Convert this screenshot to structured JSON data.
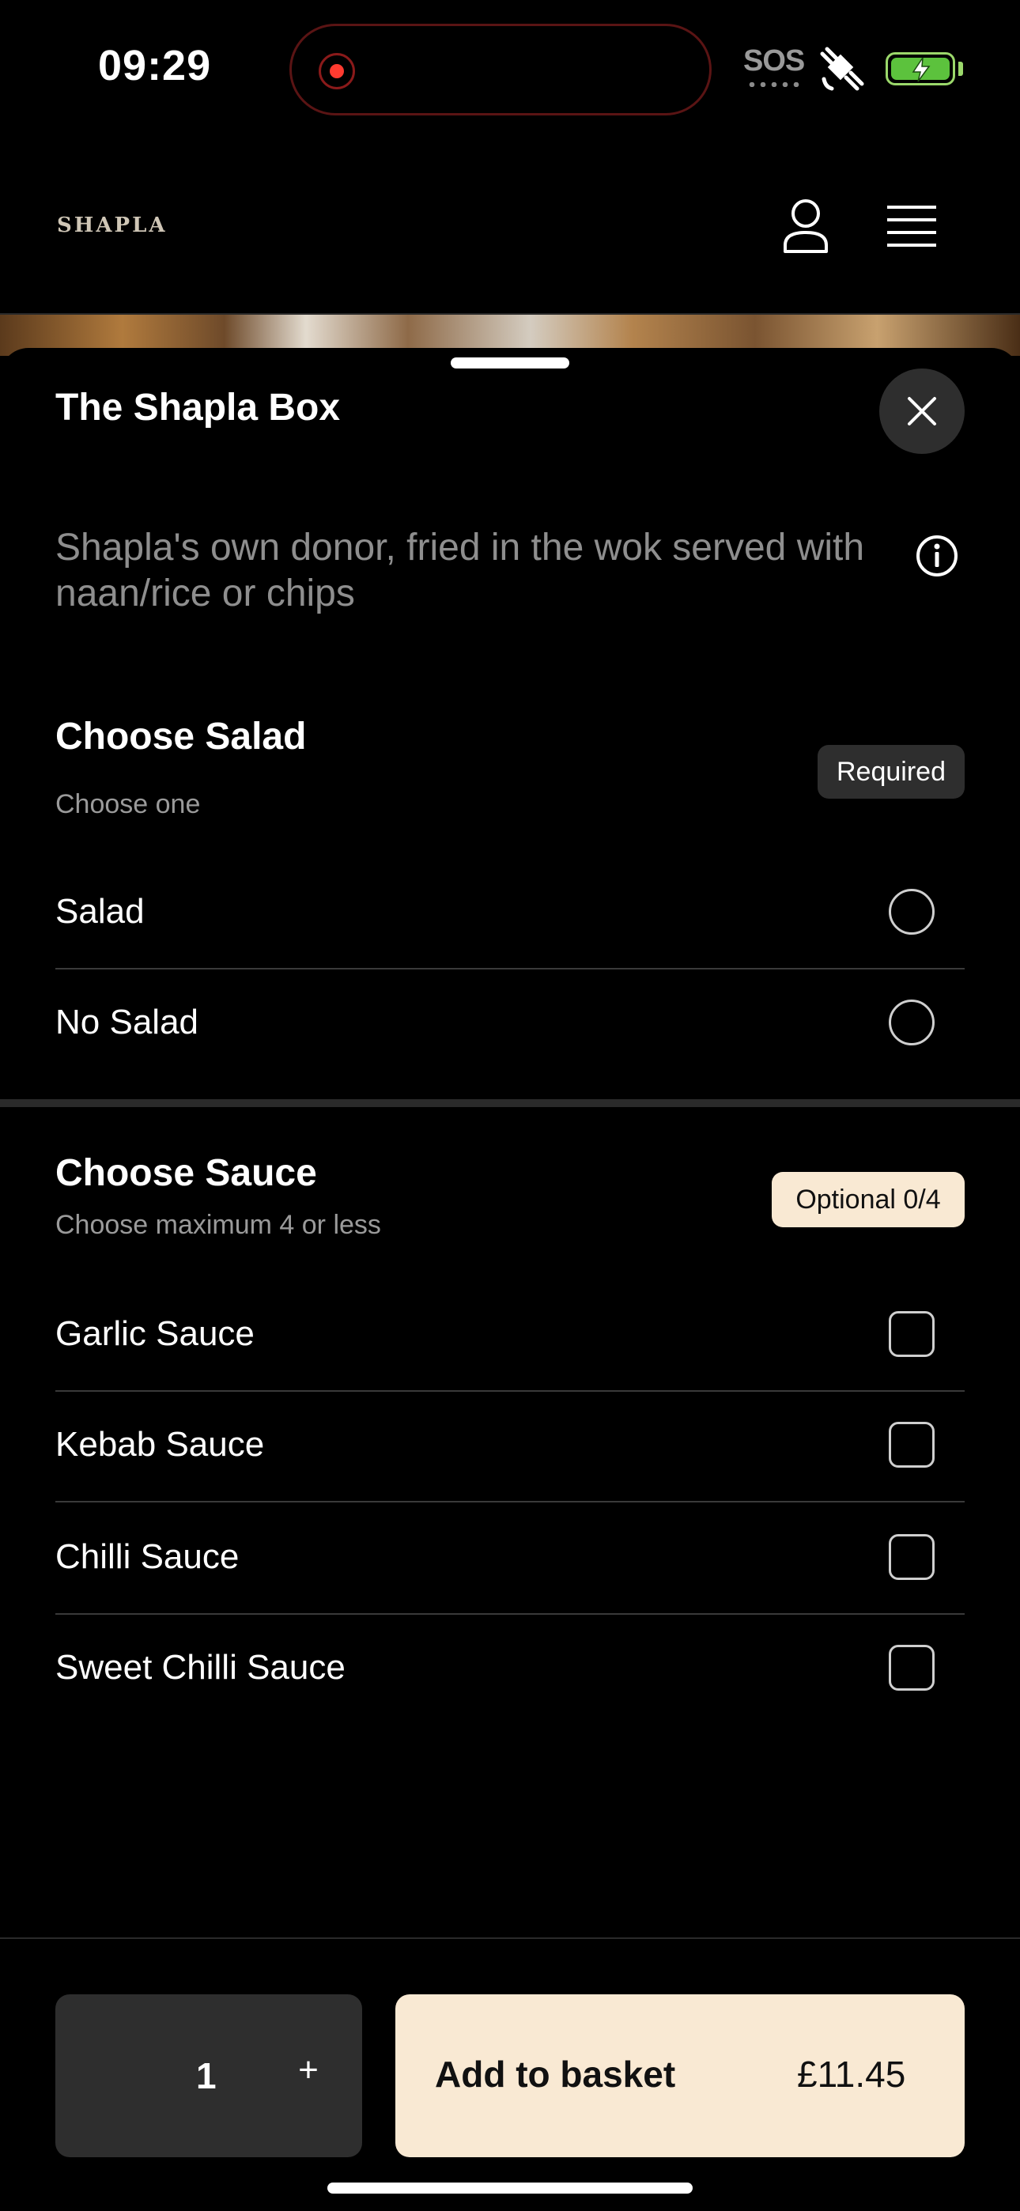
{
  "status_bar": {
    "time": "09:29",
    "sos": "SOS",
    "recording_icon": "recording-dot-icon",
    "satellite_icon": "satellite-icon",
    "battery_icon": "battery-charging-icon",
    "battery_color": "#5cc23d"
  },
  "header": {
    "logo": "SHAPLA",
    "account_icon": "user-icon",
    "menu_icon": "hamburger-menu-icon"
  },
  "item": {
    "title": "The Shapla Box",
    "description": "Shapla's own donor, fried in the wok served with naan/rice or chips",
    "close_icon": "close-icon",
    "info_icon": "info-icon"
  },
  "salad_section": {
    "title": "Choose Salad",
    "subtitle": "Choose one",
    "badge": "Required",
    "options": [
      {
        "label": "Salad",
        "selected": false
      },
      {
        "label": "No Salad",
        "selected": false
      }
    ]
  },
  "sauce_section": {
    "title": "Choose Sauce",
    "subtitle": "Choose maximum 4 or less",
    "badge": "Optional 0/4",
    "badge_color": "#f9e9d3",
    "options": [
      {
        "label": "Garlic Sauce",
        "checked": false
      },
      {
        "label": "Kebab Sauce",
        "checked": false
      },
      {
        "label": "Chilli Sauce",
        "checked": false
      },
      {
        "label": "Sweet Chilli Sauce",
        "checked": false
      }
    ]
  },
  "footer": {
    "quantity": "1",
    "plus": "+",
    "add_label": "Add to basket",
    "price": "£11.45",
    "accent": "#f9e9d3"
  }
}
